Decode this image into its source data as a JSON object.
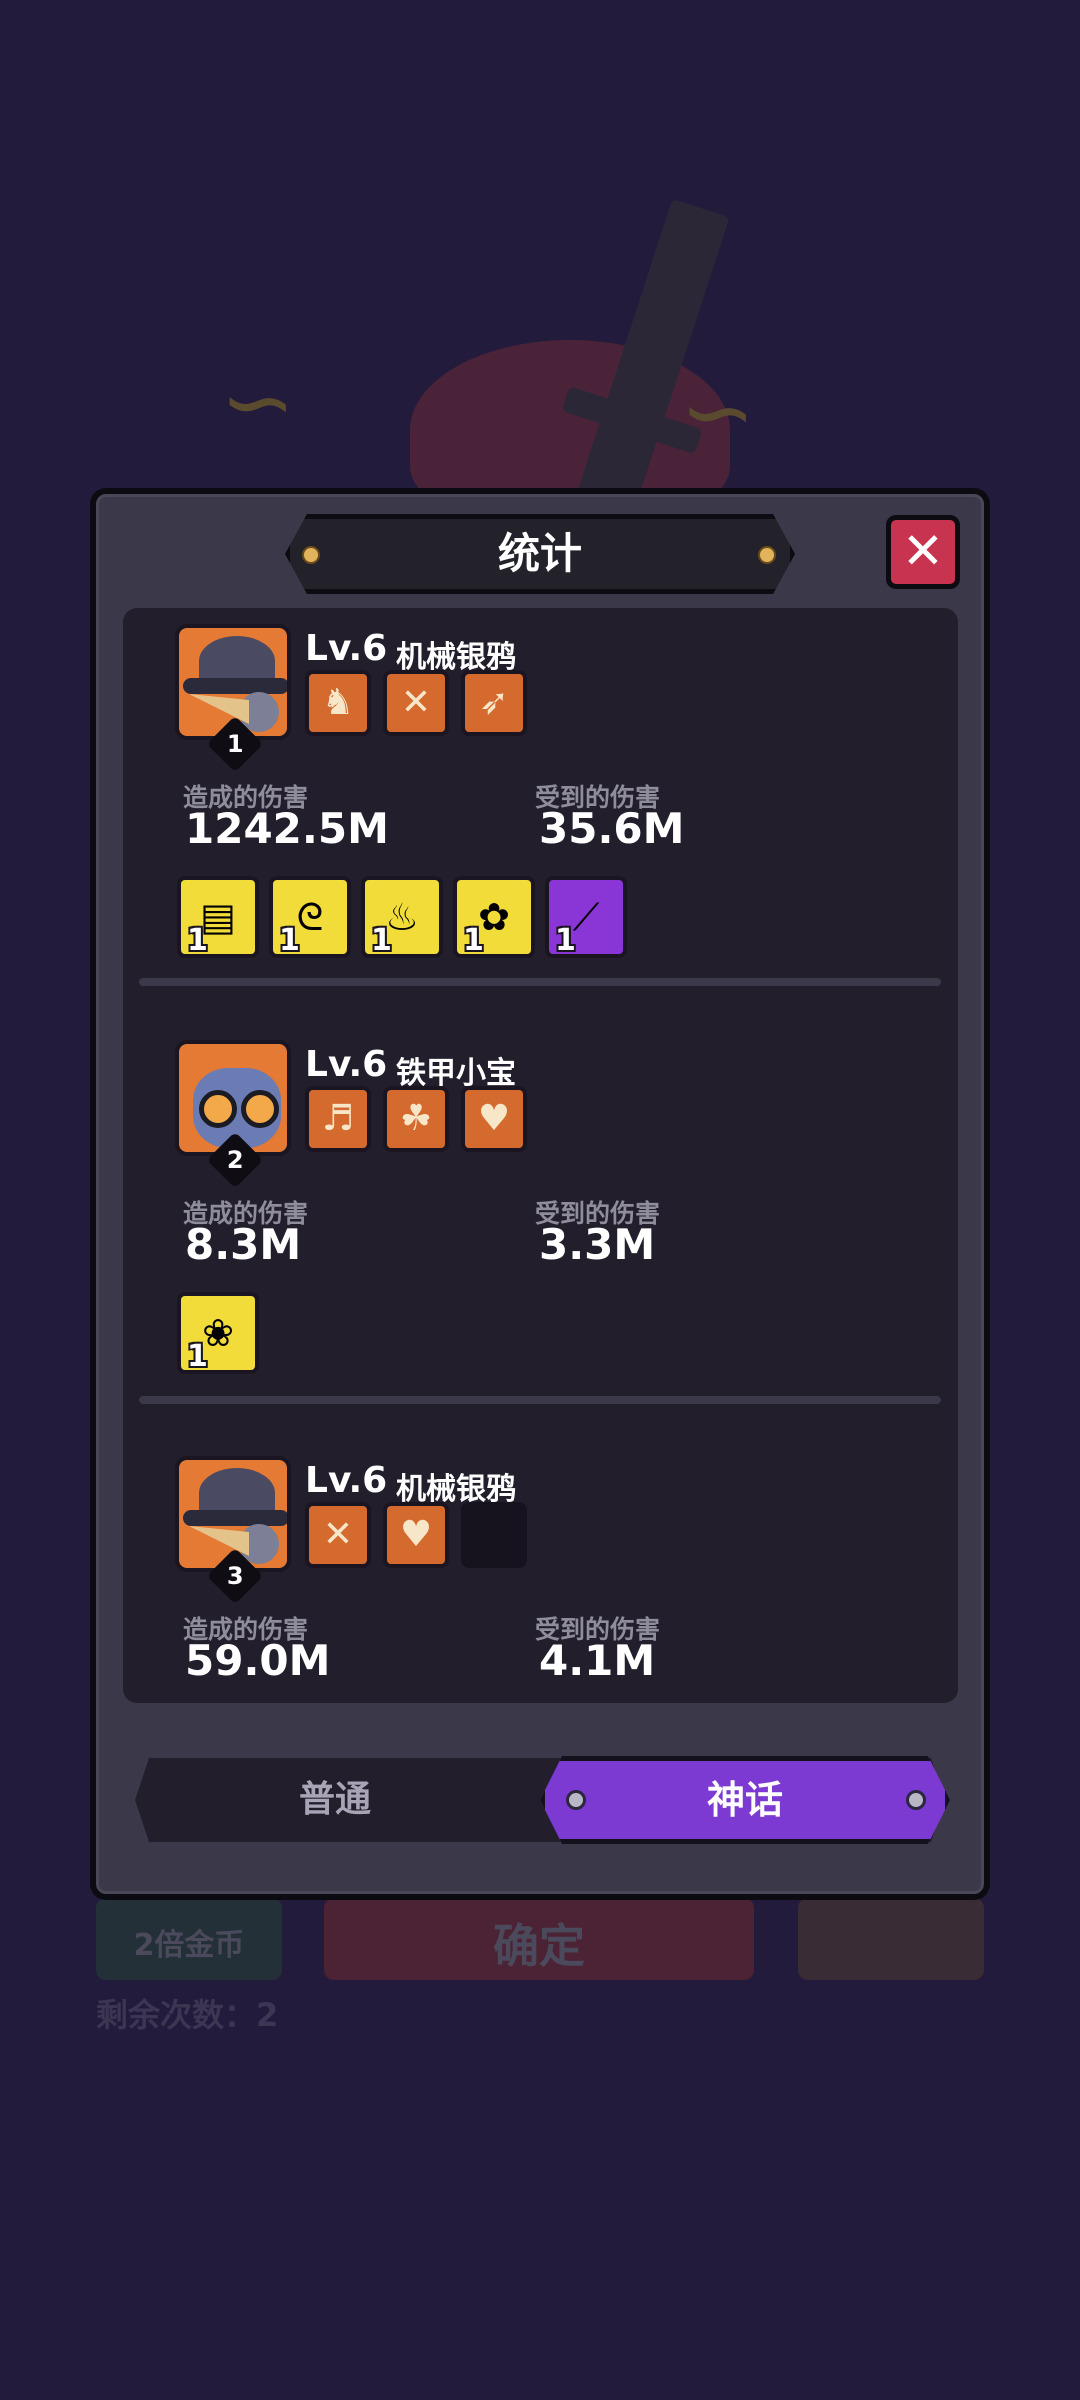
{
  "background": {
    "double_coins_label": "2倍金币",
    "confirm_label": "确定",
    "remaining_label": "剩余次数：",
    "remaining_count": "2"
  },
  "modal": {
    "title": "统计",
    "close_icon": "close-icon"
  },
  "stats": {
    "dealt_label": "造成的伤害",
    "taken_label": "受到的伤害"
  },
  "heroes": [
    {
      "rank": "1",
      "level": "Lv.6",
      "name": "机械银鸦",
      "portrait_icon": "crow-portrait-icon",
      "skills": [
        "horn-icon",
        "shuriken-icon",
        "crossbow-icon"
      ],
      "damage_dealt": "1242.5M",
      "damage_taken": "35.6M",
      "items": [
        {
          "icon": "map-scroll-icon",
          "count": "1",
          "color": "#f2dc3a"
        },
        {
          "icon": "green-swirl-icon",
          "count": "1",
          "color": "#f2dc3a"
        },
        {
          "icon": "fire-doll-icon",
          "count": "1",
          "color": "#f2dc3a"
        },
        {
          "icon": "treasure-pile-icon",
          "count": "1",
          "color": "#f2dc3a"
        },
        {
          "icon": "magic-wand-icon",
          "count": "1",
          "color": "#8a36d6"
        }
      ]
    },
    {
      "rank": "2",
      "level": "Lv.6",
      "name": "铁甲小宝",
      "portrait_icon": "robot-portrait-icon",
      "skills": [
        "golden-horn-icon",
        "leaf-blade-icon",
        "ice-heart-icon"
      ],
      "damage_dealt": "8.3M",
      "damage_taken": "3.3M",
      "items": [
        {
          "icon": "heart-flower-icon",
          "count": "1",
          "color": "#f2dc3a"
        }
      ]
    },
    {
      "rank": "3",
      "level": "Lv.6",
      "name": "机械银鸦",
      "portrait_icon": "crow-portrait-icon",
      "skills": [
        "shuriken-icon",
        "ice-heart-icon",
        "empty-slot"
      ],
      "damage_dealt": "59.0M",
      "damage_taken": "4.1M",
      "items": []
    }
  ],
  "tabs": {
    "normal": "普通",
    "mythic": "神话",
    "active": "mythic"
  }
}
